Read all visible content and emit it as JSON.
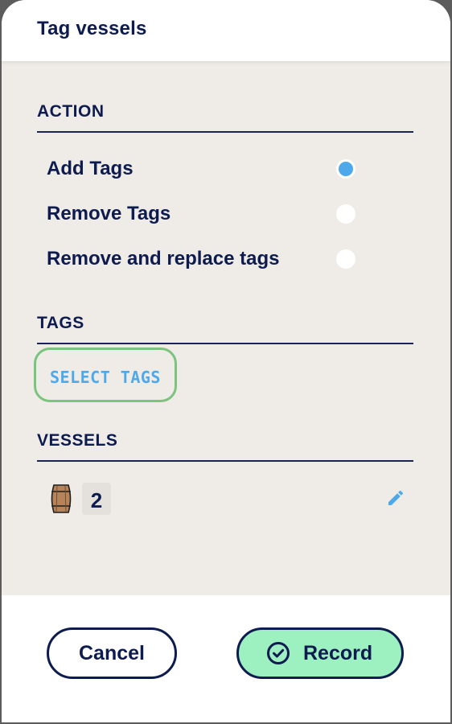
{
  "header": {
    "title": "Tag vessels"
  },
  "action": {
    "section_title": "ACTION",
    "options": [
      {
        "label": "Add Tags",
        "selected": true
      },
      {
        "label": "Remove Tags",
        "selected": false
      },
      {
        "label": "Remove and replace tags",
        "selected": false
      }
    ]
  },
  "tags": {
    "section_title": "TAGS",
    "select_label": "SELECT TAGS"
  },
  "vessels": {
    "section_title": "VESSELS",
    "count": "2",
    "vessel_icon": "barrel-icon",
    "edit_icon": "pencil-icon"
  },
  "footer": {
    "cancel_label": "Cancel",
    "record_label": "Record",
    "record_icon": "check-circle-icon"
  },
  "colors": {
    "navy": "#0d1b4f",
    "accent_blue": "#4ea9ea",
    "record_green": "#9df0c0",
    "select_border_green": "#7bc47f",
    "panel_bg": "#efece8"
  }
}
